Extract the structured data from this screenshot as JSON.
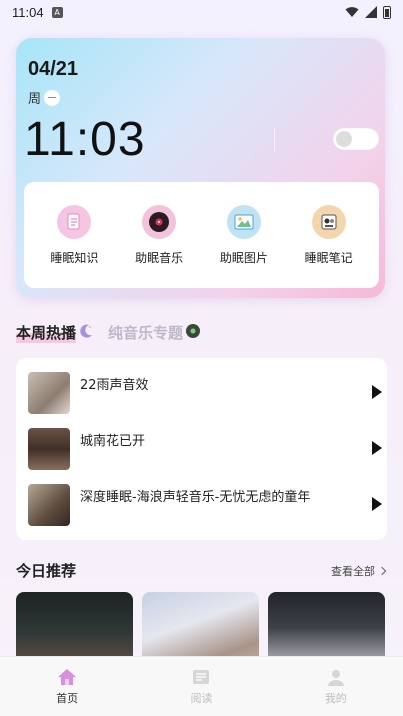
{
  "status_bar": {
    "time": "11:04",
    "notification_icon": "A"
  },
  "clock_card": {
    "date": "04/21",
    "weekday_label": "周",
    "weekday_value": "一",
    "time": "11:03"
  },
  "features": [
    {
      "label": "睡眠知识",
      "icon": "document-icon"
    },
    {
      "label": "助眠音乐",
      "icon": "vinyl-record-icon"
    },
    {
      "label": "助眠图片",
      "icon": "picture-icon"
    },
    {
      "label": "睡眠笔记",
      "icon": "notebook-icon"
    }
  ],
  "tabs": [
    {
      "label": "本周热播",
      "icon": "moon-icon",
      "active": true
    },
    {
      "label": "纯音乐专题",
      "icon": "record-icon",
      "active": false
    }
  ],
  "tracks": [
    {
      "title": "22雨声音效"
    },
    {
      "title": "城南花已开"
    },
    {
      "title": "深度睡眠-海浪声轻音乐-无忧无虑的童年"
    }
  ],
  "recommend": {
    "title": "今日推荐",
    "see_all": "查看全部"
  },
  "bottom_nav": [
    {
      "label": "首页",
      "icon": "home-icon",
      "active": true
    },
    {
      "label": "阅读",
      "icon": "book-icon",
      "active": false
    },
    {
      "label": "我的",
      "icon": "person-icon",
      "active": false
    }
  ],
  "colors": {
    "accent": "#c679d6",
    "card_gradient_start": "#a6e6f7",
    "card_gradient_end": "#f7b8d6"
  }
}
